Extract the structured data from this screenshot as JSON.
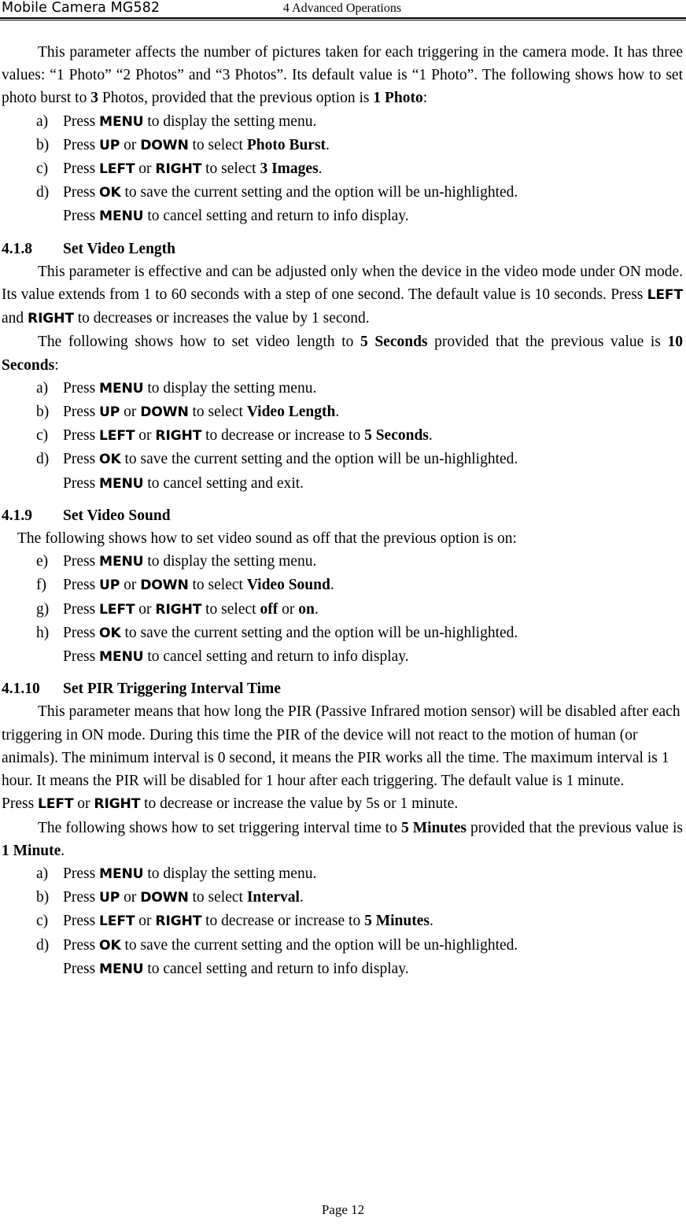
{
  "header": {
    "left_title": "Mobile Camera MG582",
    "center_title": "4 Advanced Operations"
  },
  "footer": {
    "page_label": "Page 12"
  },
  "body": {
    "photo_burst": {
      "paragraph": {
        "t1": "This parameter affects the number of pictures taken for each triggering in the camera mode. It has three values: “1 Photo” “2 Photos” and “3 Photos”. Its default value is “1 Photo”. The following shows how to set photo burst to ",
        "b1": "3",
        "t2": " Photos, provided that the previous option is ",
        "b2": "1 Photo",
        "t3": ":"
      },
      "steps": [
        {
          "marker": "a)",
          "t1": "Press ",
          "k1": "MENU",
          "t2": " to display the setting menu."
        },
        {
          "marker": "b)",
          "t1": "Press ",
          "k1": "UP",
          "t2": " or ",
          "k2": "DOWN",
          "t3": " to select ",
          "v1": "Photo Burst",
          "t4": "."
        },
        {
          "marker": "c)",
          "t1": "Press ",
          "k1": "LEFT",
          "t2": " or ",
          "k2": "RIGHT",
          "t3": " to select ",
          "v1": "3 Images",
          "t4": "."
        },
        {
          "marker": "d)",
          "t1": "Press ",
          "k1": "OK",
          "t2": " to save the current setting and the option will be un-highlighted.",
          "sub_t1": "Press ",
          "sub_k1": "MENU",
          "sub_t2": " to cancel setting and return to info display."
        }
      ]
    },
    "video_length": {
      "heading": {
        "number": "4.1.8",
        "title": "Set Video Length"
      },
      "paragraph1": {
        "t1": "This parameter is effective and can be adjusted only when the device in the video mode under ON mode. Its value extends from 1 to 60 seconds with a step of one second. The default value is 10 seconds. Press ",
        "k1": "LEFT",
        "t2": " and ",
        "k2": "RIGHT",
        "t3": " to decreases or increases the value by 1 second."
      },
      "paragraph2": {
        "t1": "The following shows how to set video length to ",
        "b1": "5 Seconds",
        "t2": " provided that the previous value is ",
        "b2": "10 Seconds",
        "t3": ":"
      },
      "steps": [
        {
          "marker": "a)",
          "t1": "Press ",
          "k1": "MENU",
          "t2": " to display the setting menu."
        },
        {
          "marker": "b)",
          "t1": "Press ",
          "k1": "UP",
          "t2": " or ",
          "k2": "DOWN",
          "t3": " to select ",
          "v1": "Video Length",
          "t4": "."
        },
        {
          "marker": "c)",
          "t1": "Press ",
          "k1": "LEFT",
          "t2": " or ",
          "k2": "RIGHT",
          "t3": " to decrease or increase to ",
          "v1": "5 Seconds",
          "t4": "."
        },
        {
          "marker": "d)",
          "t1": "Press ",
          "k1": "OK",
          "t2": " to save the current setting and the option will be un-highlighted.",
          "sub_t1": "Press ",
          "sub_k1": "MENU",
          "sub_t2": " to cancel setting and exit."
        }
      ]
    },
    "video_sound": {
      "heading": {
        "number": "4.1.9",
        "title": "Set Video Sound"
      },
      "paragraph1": {
        "t1": "The following shows how to set video sound as off that the previous option is on:"
      },
      "steps": [
        {
          "marker": "e)",
          "t1": "Press ",
          "k1": "MENU",
          "t2": " to display the setting menu."
        },
        {
          "marker": "f)",
          "t1": "Press ",
          "k1": "UP",
          "t2": " or ",
          "k2": "DOWN",
          "t3": " to select ",
          "v1": "Video Sound",
          "t4": "."
        },
        {
          "marker": "g)",
          "t1": "Press ",
          "k1": "LEFT",
          "t2": " or ",
          "k2": "RIGHT",
          "t3": " to select ",
          "v1": "off",
          "t4": " or ",
          "v2": "on",
          "t5": "."
        },
        {
          "marker": "h)",
          "t1": "Press ",
          "k1": "OK",
          "t2": " to save the current setting and the option will be un-highlighted.",
          "sub_t1": "Press ",
          "sub_k1": "MENU",
          "sub_t2": " to cancel setting and return to info display."
        }
      ]
    },
    "pir_interval": {
      "heading": {
        "number": "4.1.10",
        "title": "Set PIR Triggering Interval Time"
      },
      "paragraph1": {
        "t1": "This parameter means that how long the PIR (Passive Infrared motion sensor) will be disabled after each triggering in ON mode. During this time the PIR of the device will not react to the motion of human (or animals). The minimum interval is 0 second, it means the PIR works all the time. The maximum interval is 1 hour. It means the PIR will be disabled for 1 hour after each triggering. The default value is 1 minute.",
        "t2": "Press ",
        "k1": "LEFT",
        "t3": " or ",
        "k2": "RIGHT",
        "t4": " to decrease or increase the value by 5s or 1 minute."
      },
      "paragraph2": {
        "t1": "The following shows how to set triggering interval time to ",
        "b1": "5 Minutes",
        "t2": " provided that the previous value is ",
        "b2": "1 Minute",
        "t3": "."
      },
      "steps": [
        {
          "marker": "a)",
          "t1": "Press ",
          "k1": "MENU",
          "t2": " to display the setting menu."
        },
        {
          "marker": "b)",
          "t1": "Press ",
          "k1": "UP",
          "t2": " or ",
          "k2": "DOWN",
          "t3": " to select ",
          "v1": "Interval",
          "t4": "."
        },
        {
          "marker": "c)",
          "t1": "Press ",
          "k1": "LEFT",
          "t2": " or ",
          "k2": "RIGHT",
          "t3": " to decrease or increase to ",
          "v1": "5 Minutes",
          "t4": "."
        },
        {
          "marker": "d)",
          "t1": "Press ",
          "k1": "OK",
          "t2": " to save the current setting and the option will be un-highlighted.",
          "sub_t1": "Press ",
          "sub_k1": "MENU",
          "sub_t2": " to cancel setting and return to info display."
        }
      ]
    }
  }
}
